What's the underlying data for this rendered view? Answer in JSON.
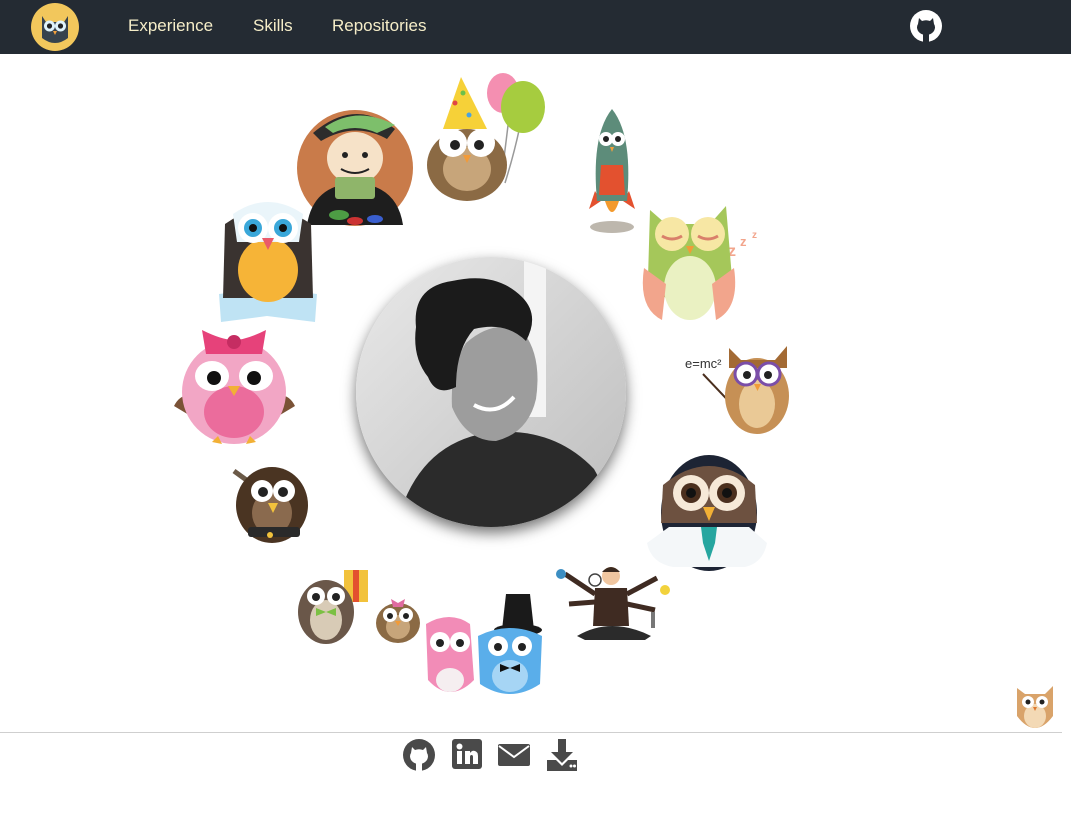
{
  "nav": {
    "brand_icon": "owl-logo-icon",
    "links": [
      {
        "label": "Experience"
      },
      {
        "label": "Skills"
      },
      {
        "label": "Repositories"
      }
    ],
    "github_icon": "github-icon"
  },
  "center": {
    "portrait": "profile-photo"
  },
  "orbit_owls": [
    "gambler-owl",
    "party-owl",
    "rocket-owl",
    "sleepy-owl",
    "professor-owl",
    "business-owl",
    "multitask-person",
    "wedding-owls",
    "small-owl",
    "gift-owl",
    "mechanic-owl",
    "pink-bow-owl",
    "book-owl"
  ],
  "footer": {
    "icons": [
      "github-icon",
      "linkedin-icon",
      "email-icon",
      "download-icon"
    ]
  },
  "colors": {
    "navbar_bg": "#242b33",
    "nav_text": "#f5edc8",
    "logo_bg": "#f2c75c"
  }
}
